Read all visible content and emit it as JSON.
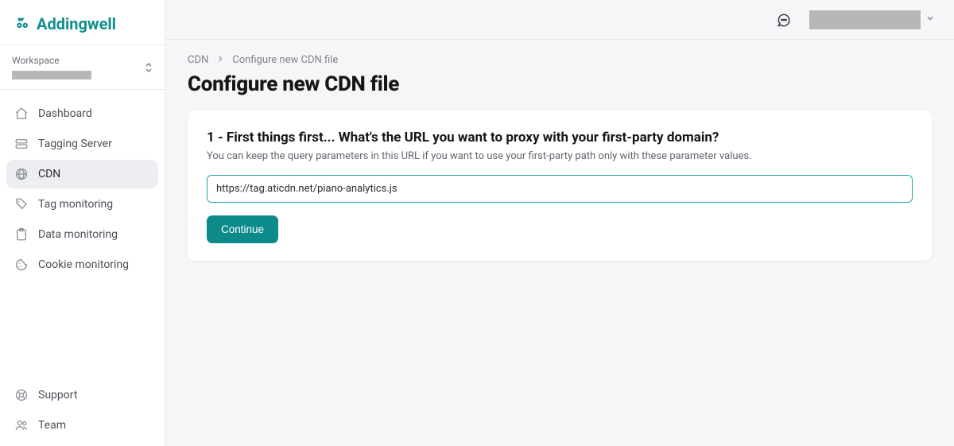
{
  "brand": {
    "name": "Addingwell"
  },
  "workspace": {
    "label": "Workspace"
  },
  "nav": {
    "items": [
      {
        "label": "Dashboard",
        "icon": "home-icon"
      },
      {
        "label": "Tagging Server",
        "icon": "server-icon"
      },
      {
        "label": "CDN",
        "icon": "globe-icon",
        "active": true
      },
      {
        "label": "Tag monitoring",
        "icon": "tag-icon"
      },
      {
        "label": "Data monitoring",
        "icon": "clipboard-icon"
      },
      {
        "label": "Cookie monitoring",
        "icon": "cookie-icon"
      }
    ],
    "bottom": [
      {
        "label": "Support",
        "icon": "support-icon"
      },
      {
        "label": "Team",
        "icon": "team-icon"
      }
    ]
  },
  "breadcrumb": {
    "parent": "CDN",
    "current": "Configure new CDN file"
  },
  "page": {
    "title": "Configure new CDN file"
  },
  "form": {
    "step_heading": "1 - First things first... What's the URL you want to proxy with your first-party domain?",
    "step_help": "You can keep the query parameters in this URL if you want to use your first-party path only with these parameter values.",
    "url_value": "https://tag.aticdn.net/piano-analytics.js",
    "continue_label": "Continue"
  }
}
